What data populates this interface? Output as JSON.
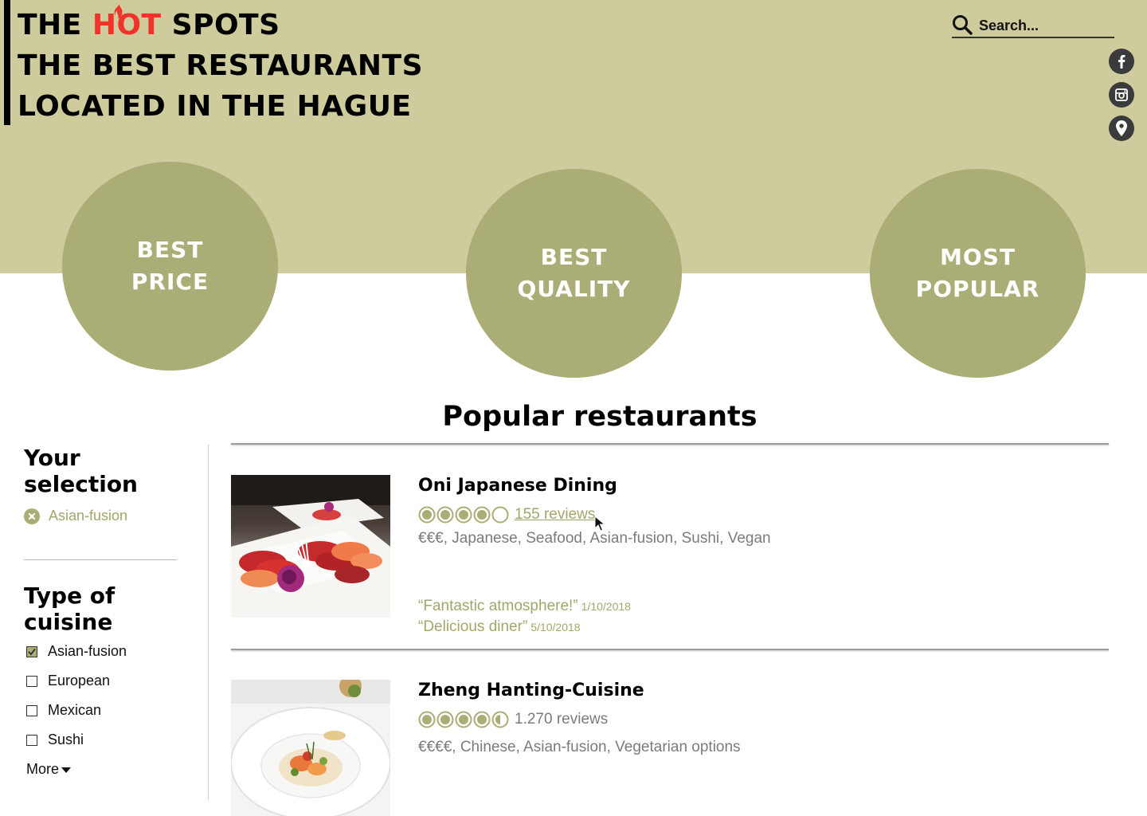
{
  "brand": {
    "line1_pre": "THE ",
    "line1_hot": "HOT",
    "line1_post": " SPOTS",
    "line2": "THE BEST RESTAURANTS",
    "line3": "LOCATED IN THE HAGUE"
  },
  "search": {
    "placeholder": "Search..."
  },
  "social": [
    "facebook-icon",
    "instagram-icon",
    "location-pin-icon"
  ],
  "categories": [
    {
      "line1": "BEST",
      "line2": "PRICE"
    },
    {
      "line1": "BEST",
      "line2": "QUALITY"
    },
    {
      "line1": "MOST",
      "line2": "POPULAR"
    }
  ],
  "section_title": "Popular restaurants",
  "sidebar": {
    "selection_heading_1": "Your",
    "selection_heading_2": "selection",
    "selected": [
      "Asian-fusion"
    ],
    "cuisine_heading_1": "Type of",
    "cuisine_heading_2": "cuisine",
    "cuisine_options": [
      {
        "label": "Asian-fusion",
        "checked": true
      },
      {
        "label": "European",
        "checked": false
      },
      {
        "label": "Mexican",
        "checked": false
      },
      {
        "label": "Sushi",
        "checked": false
      }
    ],
    "more_label": "More"
  },
  "restaurants": [
    {
      "name": "Oni Japanese Dining",
      "rating": 4,
      "reviews": "155 reviews",
      "tags": "€€€, Japanese, Seafood, Asian-fusion, Sushi, Vegan",
      "quotes": [
        {
          "text": "“Fantastic atmosphere!”",
          "date": "1/10/2018"
        },
        {
          "text": "“Delicious diner”",
          "date": "5/10/2018"
        }
      ]
    },
    {
      "name": "Zheng Hanting-Cuisine",
      "rating": 4.5,
      "reviews": "1.270 reviews",
      "tags": "€€€€, Chinese, Asian-fusion, Vegetarian options",
      "quotes": []
    }
  ],
  "colors": {
    "hero": "#cecb9d",
    "accent": "#aaad76",
    "accent_text": "#a3a66b",
    "hot": "#f0322a",
    "social_bg": "#3b3b3b"
  }
}
